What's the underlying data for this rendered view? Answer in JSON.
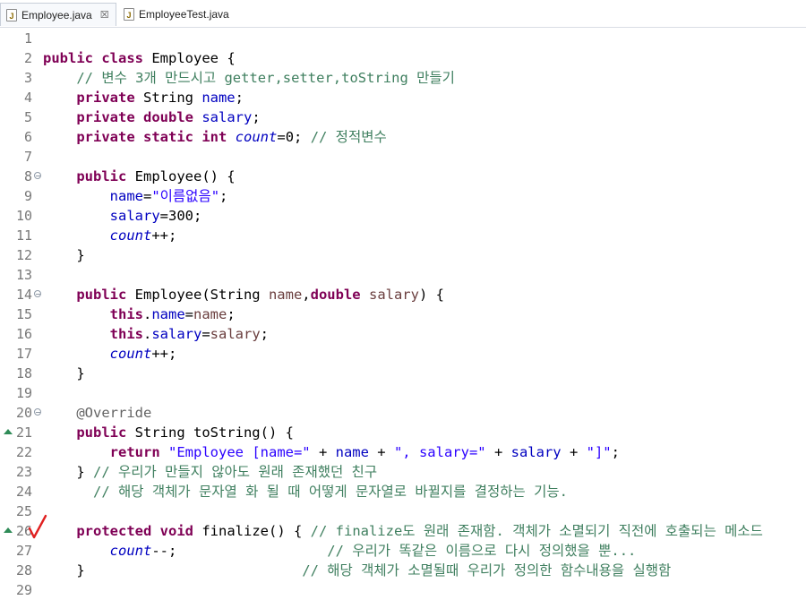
{
  "tabs": [
    {
      "label": "Employee.java",
      "active": true,
      "close_glyph": "☒"
    },
    {
      "label": "EmployeeTest.java",
      "active": false
    }
  ],
  "colors": {
    "keyword": "#7f0055",
    "comment": "#3f7f5f",
    "string": "#2a00ff",
    "field": "#0000c0",
    "annotation": "#646464",
    "parameter": "#6a3e3e",
    "line_number": "#787878",
    "override_marker": "#2e8b57",
    "check_mark": "#e02020"
  },
  "gutter_icons": {
    "fold": "fold-collapse-icon",
    "override": "override-arrow-icon"
  },
  "lines": [
    {
      "n": "1",
      "tokens": []
    },
    {
      "n": "2",
      "tokens": [
        [
          "kw",
          "public"
        ],
        [
          "t",
          " "
        ],
        [
          "kw",
          "class"
        ],
        [
          "t",
          " Employee {"
        ]
      ]
    },
    {
      "n": "3",
      "tokens": [
        [
          "t",
          "    "
        ],
        [
          "cm",
          "// 변수 3개 만드시고 getter,setter,toString 만들기"
        ]
      ]
    },
    {
      "n": "4",
      "tokens": [
        [
          "t",
          "    "
        ],
        [
          "kw",
          "private"
        ],
        [
          "t",
          " String "
        ],
        [
          "fld",
          "name"
        ],
        [
          "t",
          ";"
        ]
      ]
    },
    {
      "n": "5",
      "tokens": [
        [
          "t",
          "    "
        ],
        [
          "kw",
          "private"
        ],
        [
          "t",
          " "
        ],
        [
          "kw",
          "double"
        ],
        [
          "t",
          " "
        ],
        [
          "fld",
          "salary"
        ],
        [
          "t",
          ";"
        ]
      ]
    },
    {
      "n": "6",
      "tokens": [
        [
          "t",
          "    "
        ],
        [
          "kw",
          "private"
        ],
        [
          "t",
          " "
        ],
        [
          "kw",
          "static"
        ],
        [
          "t",
          " "
        ],
        [
          "kw",
          "int"
        ],
        [
          "t",
          " "
        ],
        [
          "sfld",
          "count"
        ],
        [
          "t",
          "=0; "
        ],
        [
          "cm",
          "// 정적변수"
        ]
      ]
    },
    {
      "n": "7",
      "tokens": []
    },
    {
      "n": "8",
      "fold": true,
      "tokens": [
        [
          "t",
          "    "
        ],
        [
          "kw",
          "public"
        ],
        [
          "t",
          " Employee() {"
        ]
      ]
    },
    {
      "n": "9",
      "tokens": [
        [
          "t",
          "        "
        ],
        [
          "fld",
          "name"
        ],
        [
          "t",
          "="
        ],
        [
          "str",
          "\"이름없음\""
        ],
        [
          "t",
          ";"
        ]
      ]
    },
    {
      "n": "10",
      "tokens": [
        [
          "t",
          "        "
        ],
        [
          "fld",
          "salary"
        ],
        [
          "t",
          "=300;"
        ]
      ]
    },
    {
      "n": "11",
      "tokens": [
        [
          "t",
          "        "
        ],
        [
          "sfld",
          "count"
        ],
        [
          "t",
          "++;"
        ]
      ]
    },
    {
      "n": "12",
      "tokens": [
        [
          "t",
          "    }"
        ]
      ]
    },
    {
      "n": "13",
      "tokens": []
    },
    {
      "n": "14",
      "fold": true,
      "tokens": [
        [
          "t",
          "    "
        ],
        [
          "kw",
          "public"
        ],
        [
          "t",
          " Employee(String "
        ],
        [
          "par",
          "name"
        ],
        [
          "t",
          ","
        ],
        [
          "kw",
          "double"
        ],
        [
          "t",
          " "
        ],
        [
          "par",
          "salary"
        ],
        [
          "t",
          ") {"
        ]
      ]
    },
    {
      "n": "15",
      "tokens": [
        [
          "t",
          "        "
        ],
        [
          "kw",
          "this"
        ],
        [
          "t",
          "."
        ],
        [
          "fld",
          "name"
        ],
        [
          "t",
          "="
        ],
        [
          "par",
          "name"
        ],
        [
          "t",
          ";"
        ]
      ]
    },
    {
      "n": "16",
      "tokens": [
        [
          "t",
          "        "
        ],
        [
          "kw",
          "this"
        ],
        [
          "t",
          "."
        ],
        [
          "fld",
          "salary"
        ],
        [
          "t",
          "="
        ],
        [
          "par",
          "salary"
        ],
        [
          "t",
          ";"
        ]
      ]
    },
    {
      "n": "17",
      "tokens": [
        [
          "t",
          "        "
        ],
        [
          "sfld",
          "count"
        ],
        [
          "t",
          "++;"
        ]
      ]
    },
    {
      "n": "18",
      "tokens": [
        [
          "t",
          "    }"
        ]
      ]
    },
    {
      "n": "19",
      "tokens": []
    },
    {
      "n": "20",
      "fold": true,
      "tokens": [
        [
          "t",
          "    "
        ],
        [
          "ann",
          "@Override"
        ]
      ]
    },
    {
      "n": "21",
      "override": true,
      "tokens": [
        [
          "t",
          "    "
        ],
        [
          "kw",
          "public"
        ],
        [
          "t",
          " String toString() {"
        ]
      ]
    },
    {
      "n": "22",
      "tokens": [
        [
          "t",
          "        "
        ],
        [
          "kw",
          "return"
        ],
        [
          "t",
          " "
        ],
        [
          "str",
          "\"Employee [name=\""
        ],
        [
          "t",
          " + "
        ],
        [
          "fld",
          "name"
        ],
        [
          "t",
          " + "
        ],
        [
          "str",
          "\", salary=\""
        ],
        [
          "t",
          " + "
        ],
        [
          "fld",
          "salary"
        ],
        [
          "t",
          " + "
        ],
        [
          "str",
          "\"]\""
        ],
        [
          "t",
          ";"
        ]
      ]
    },
    {
      "n": "23",
      "tokens": [
        [
          "t",
          "    } "
        ],
        [
          "cm",
          "// 우리가 만들지 않아도 원래 존재했던 친구"
        ]
      ]
    },
    {
      "n": "24",
      "tokens": [
        [
          "t",
          "      "
        ],
        [
          "cm",
          "// 해당 객체가 문자열 화 될 때 어떻게 문자열로 바뀔지를 결정하는 기능."
        ]
      ]
    },
    {
      "n": "25",
      "tokens": []
    },
    {
      "n": "26",
      "override": true,
      "tokens": [
        [
          "t",
          "    "
        ],
        [
          "kw",
          "protected"
        ],
        [
          "t",
          " "
        ],
        [
          "kw",
          "void"
        ],
        [
          "t",
          " finalize() { "
        ],
        [
          "cm",
          "// finalize도 원래 존재함. 객체가 소멸되기 직전에 호출되는 메소드"
        ]
      ]
    },
    {
      "n": "27",
      "tokens": [
        [
          "t",
          "        "
        ],
        [
          "sfld",
          "count"
        ],
        [
          "t",
          "--;                  "
        ],
        [
          "cm",
          "// 우리가 똑같은 이름으로 다시 정의했을 뿐..."
        ]
      ]
    },
    {
      "n": "28",
      "tokens": [
        [
          "t",
          "    }                          "
        ],
        [
          "cm",
          "// 해당 객체가 소멸될때 우리가 정의한 함수내용을 실행함"
        ]
      ]
    },
    {
      "n": "29",
      "tokens": []
    }
  ]
}
